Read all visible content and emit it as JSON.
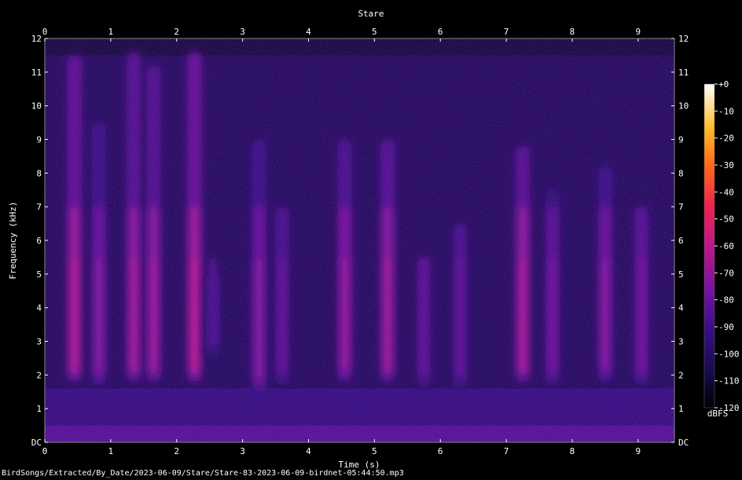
{
  "chart_data": {
    "type": "heatmap",
    "title": "Stare",
    "xlabel": "Time (s)",
    "ylabel": "Frequency (kHz)",
    "xlim": [
      0,
      9.55
    ],
    "ylim": [
      0,
      12
    ],
    "x_ticks": [
      "0",
      "1",
      "2",
      "3",
      "4",
      "5",
      "6",
      "7",
      "8",
      "9"
    ],
    "y_ticks": [
      "DC",
      "1",
      "2",
      "3",
      "4",
      "5",
      "6",
      "7",
      "8",
      "9",
      "10",
      "11",
      "12"
    ],
    "colorbar": {
      "label": "dBFS",
      "ticks": [
        "+0",
        "-10",
        "-20",
        "-30",
        "-40",
        "-50",
        "-60",
        "-70",
        "-80",
        "-90",
        "-100",
        "-110",
        "-120"
      ],
      "range": [
        -120,
        0
      ],
      "colors": [
        "#000000",
        "#1a0a55",
        "#3a0f8a",
        "#7a12a0",
        "#c0178a",
        "#f02050",
        "#ff6a1a",
        "#ffc030",
        "#ffffff"
      ]
    },
    "background_energy_dBFS": -100,
    "signal_cutoff_kHz": 11.5,
    "calls": [
      {
        "t": 0.45,
        "f_low": 1.8,
        "f_high": 11.5,
        "peak_dBFS": -62
      },
      {
        "t": 0.82,
        "f_low": 1.7,
        "f_high": 9.5,
        "peak_dBFS": -72
      },
      {
        "t": 1.35,
        "f_low": 1.8,
        "f_high": 11.6,
        "peak_dBFS": -65
      },
      {
        "t": 1.65,
        "f_low": 1.8,
        "f_high": 11.2,
        "peak_dBFS": -66
      },
      {
        "t": 2.27,
        "f_low": 1.8,
        "f_high": 11.6,
        "peak_dBFS": -60
      },
      {
        "t": 2.55,
        "f_low": 2.5,
        "f_high": 5.0,
        "peak_dBFS": -84
      },
      {
        "t": 3.25,
        "f_low": 1.5,
        "f_high": 9.0,
        "peak_dBFS": -72
      },
      {
        "t": 3.6,
        "f_low": 1.7,
        "f_high": 7.0,
        "peak_dBFS": -80
      },
      {
        "t": 4.55,
        "f_low": 1.8,
        "f_high": 9.0,
        "peak_dBFS": -68
      },
      {
        "t": 5.2,
        "f_low": 1.8,
        "f_high": 9.0,
        "peak_dBFS": -66
      },
      {
        "t": 5.75,
        "f_low": 1.6,
        "f_high": 5.5,
        "peak_dBFS": -80
      },
      {
        "t": 6.3,
        "f_low": 1.6,
        "f_high": 6.5,
        "peak_dBFS": -80
      },
      {
        "t": 7.25,
        "f_low": 1.8,
        "f_high": 8.8,
        "peak_dBFS": -64
      },
      {
        "t": 7.7,
        "f_low": 1.7,
        "f_high": 7.5,
        "peak_dBFS": -76
      },
      {
        "t": 8.5,
        "f_low": 1.8,
        "f_high": 8.2,
        "peak_dBFS": -72
      },
      {
        "t": 9.05,
        "f_low": 1.7,
        "f_high": 7.0,
        "peak_dBFS": -76
      }
    ]
  },
  "footer": {
    "file_path": "BirdSongs/Extracted/By_Date/2023-06-09/Stare/Stare-83-2023-06-09-birdnet-05:44:50.mp3"
  }
}
